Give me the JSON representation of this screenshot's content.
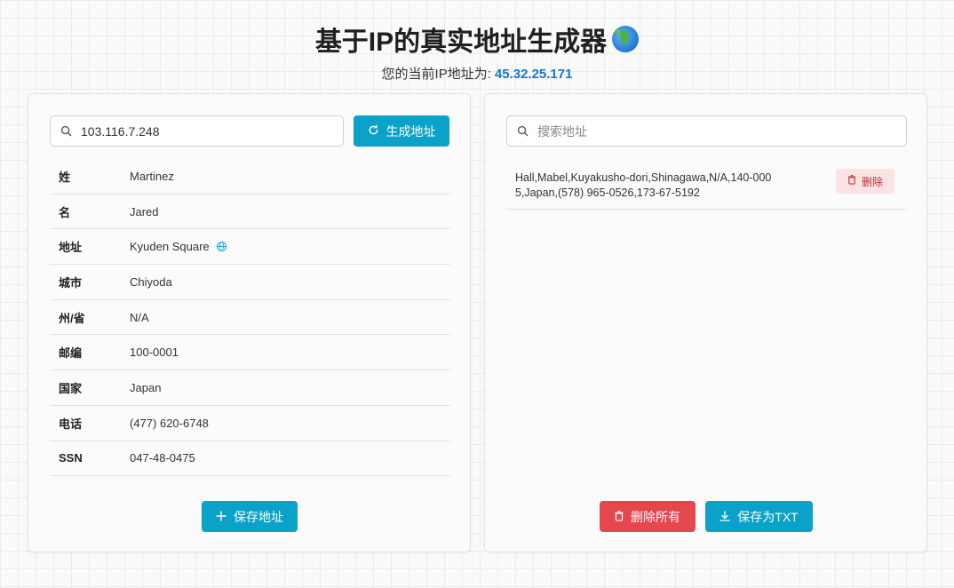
{
  "header": {
    "title": "基于IP的真实地址生成器",
    "title_icon": "globe-emoji-icon",
    "subtitle_prefix": "您的当前IP地址为:",
    "current_ip": "45.32.25.171"
  },
  "left": {
    "ip_input_value": "103.116.7.248",
    "generate_label": "生成地址",
    "rows": [
      {
        "key": "姓",
        "value": "Martinez"
      },
      {
        "key": "名",
        "value": "Jared"
      },
      {
        "key": "地址",
        "value": "Kyuden Square"
      },
      {
        "key": "城市",
        "value": "Chiyoda"
      },
      {
        "key": "州/省",
        "value": "N/A"
      },
      {
        "key": "邮编",
        "value": "100-0001"
      },
      {
        "key": "国家",
        "value": "Japan"
      },
      {
        "key": "电话",
        "value": "(477) 620-6748"
      },
      {
        "key": "SSN",
        "value": "047-48-0475"
      }
    ],
    "save_label": "保存地址"
  },
  "right": {
    "search_placeholder": "搜索地址",
    "saved": [
      {
        "text": "Hall,Mabel,Kuyakusho-dori,Shinagawa,N/A,140-0005,Japan,(578) 965-0526,173-67-5192",
        "delete_label": "删除"
      }
    ],
    "delete_all_label": "删除所有",
    "save_txt_label": "保存为TXT"
  },
  "colors": {
    "accent": "#0aa2c8",
    "danger": "#e5474f",
    "ip_highlight": "#1677c9"
  }
}
